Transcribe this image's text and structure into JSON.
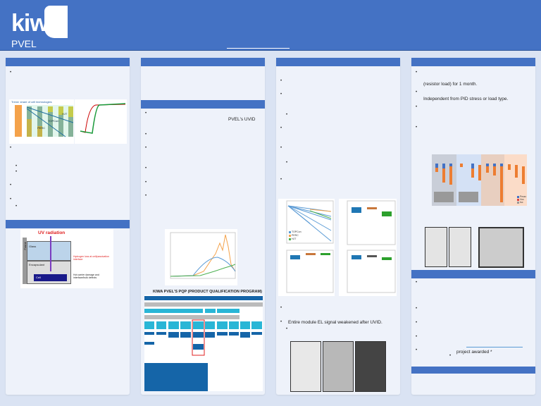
{
  "header": {
    "logo": "kiwa",
    "org": "PVEL"
  },
  "col2": {
    "uvid_label": "PVEL's UVID",
    "pqp_title": "KIWA PVEL'S PQP (PRODUCT QUALIFICATION PROGRAM)"
  },
  "col1": {
    "share_title": "Trend: share of cell technologies",
    "techs": [
      "PERC",
      "TOPCon",
      "HJT"
    ],
    "uv": {
      "uv": "UV radiation",
      "glass": "Glass",
      "enc": "Encapsulant",
      "cell": "Cell",
      "h": "Hydrogen loss at cell/passivation interface",
      "hot": "Hot carrier damage and interface/bulk defects",
      "frame": "Frame"
    }
  },
  "col3": {
    "el_text": "Entire module EL signal weakened after UVID.",
    "legend": [
      "TOPCon",
      "PERC",
      "HJT"
    ]
  },
  "col4": {
    "line1": "(resistor load) for 1 month.",
    "line2": "Independent from PID stress or load type.",
    "awarded": "project awarded *",
    "legend": [
      "Pmax",
      "Voc",
      "Isc"
    ]
  },
  "colors": {
    "brand": "#4472c4",
    "bg": "#dae3f3"
  }
}
